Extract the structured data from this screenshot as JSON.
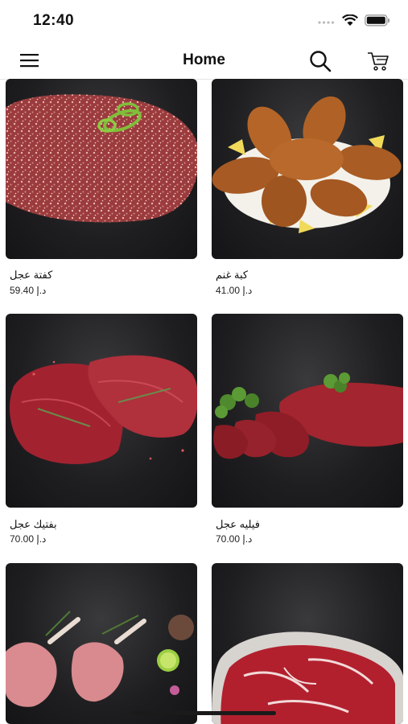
{
  "status_bar": {
    "time": "12:40"
  },
  "header": {
    "title": "Home"
  },
  "products": [
    {
      "name": "كفتة عجل",
      "currency": "د.إ",
      "price": "59.40"
    },
    {
      "name": "كبة غنم",
      "currency": "د.إ",
      "price": "41.00"
    },
    {
      "name": "بفتيك عجل",
      "currency": "د.إ",
      "price": "70.00"
    },
    {
      "name": "فيليه عجل",
      "currency": "د.إ",
      "price": "70.00"
    },
    {
      "name": "",
      "currency": "",
      "price": ""
    },
    {
      "name": "",
      "currency": "",
      "price": ""
    }
  ]
}
